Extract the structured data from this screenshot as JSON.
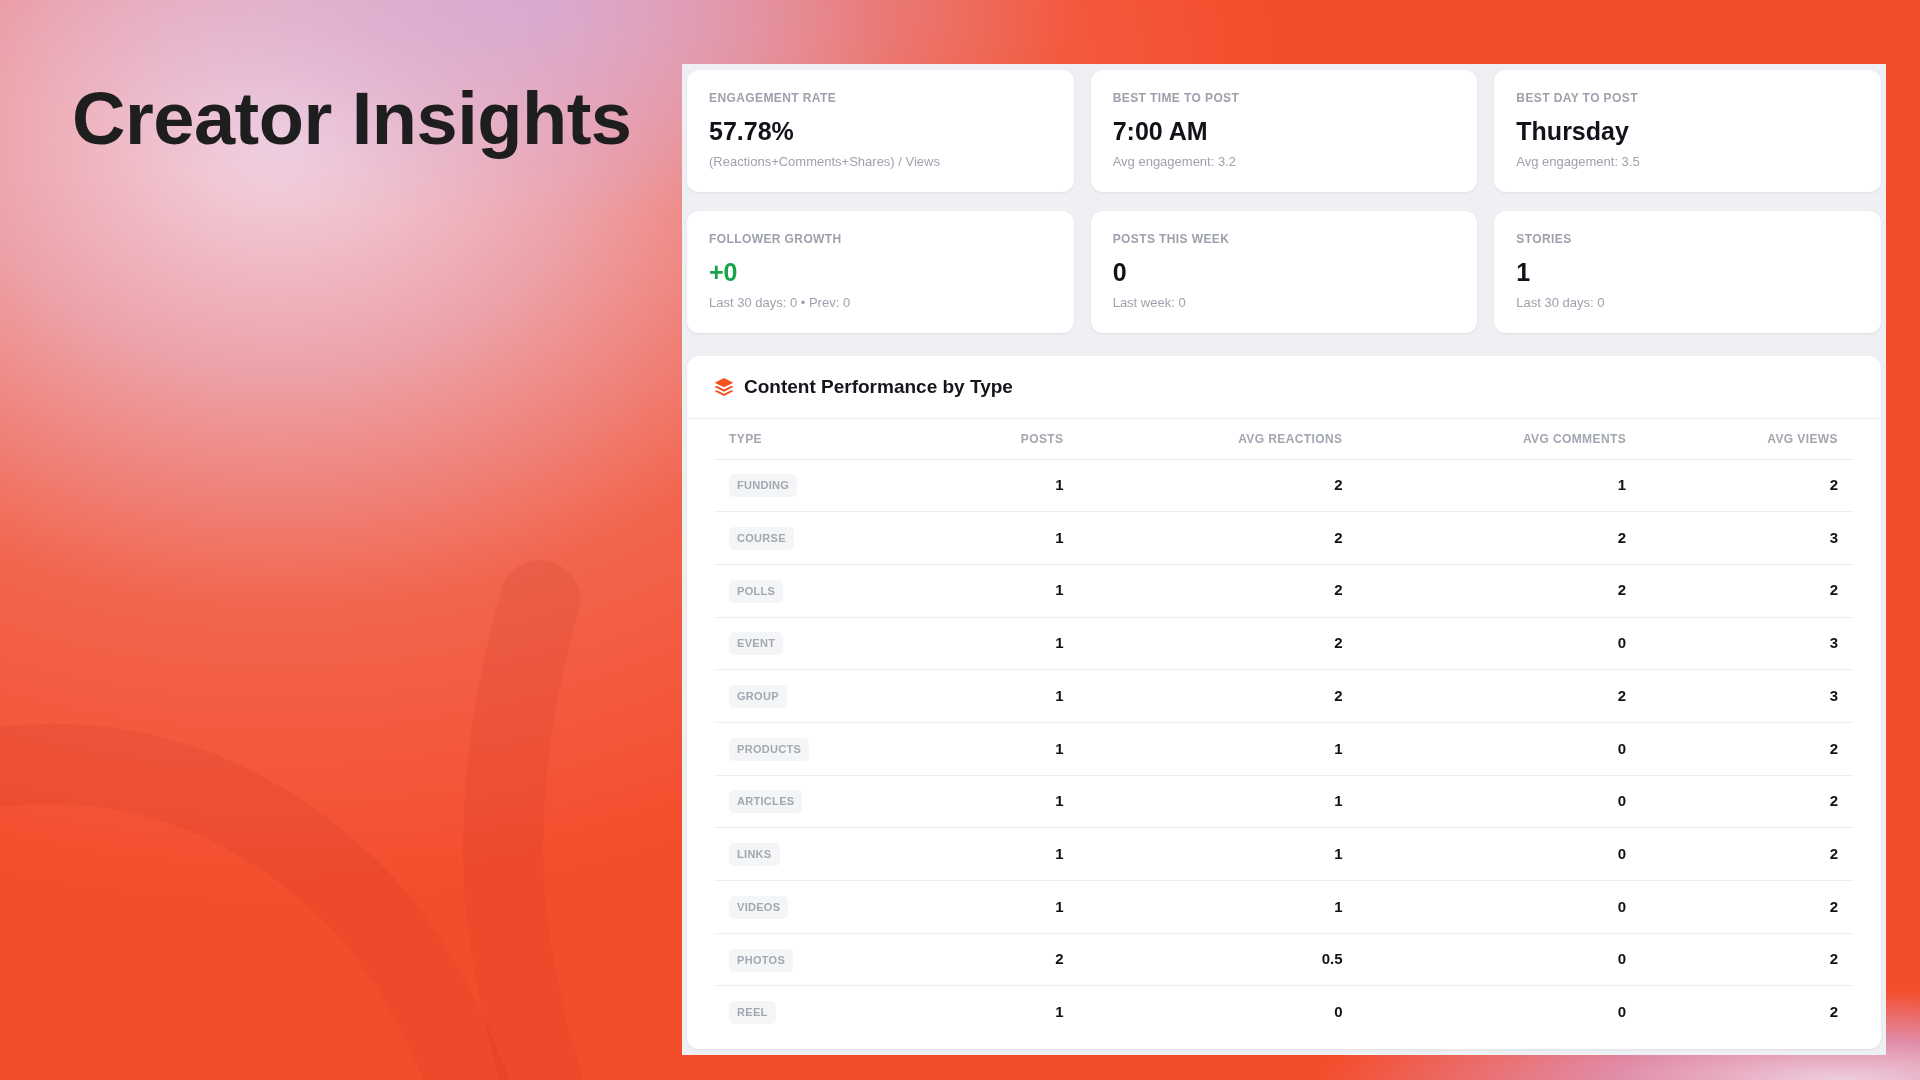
{
  "title": "Creator Insights",
  "stat_cards": [
    {
      "label": "ENGAGEMENT RATE",
      "value": "57.78%",
      "note": "(Reactions+Comments+Shares) / Views",
      "kind": "neutral"
    },
    {
      "label": "BEST TIME TO POST",
      "value": "7:00 AM",
      "note": "Avg engagement: 3.2",
      "kind": "neutral"
    },
    {
      "label": "BEST DAY TO POST",
      "value": "Thursday",
      "note": "Avg engagement: 3.5",
      "kind": "neutral"
    },
    {
      "label": "FOLLOWER GROWTH",
      "value": "+0",
      "note": "Last 30 days: 0 • Prev: 0",
      "kind": "positive"
    },
    {
      "label": "POSTS THIS WEEK",
      "value": "0",
      "note": "Last week: 0",
      "kind": "neutral"
    },
    {
      "label": "STORIES",
      "value": "1",
      "note": "Last 30 days: 0",
      "kind": "neutral"
    }
  ],
  "performance_table": {
    "title": "Content Performance by Type",
    "columns": [
      "TYPE",
      "POSTS",
      "AVG REACTIONS",
      "AVG COMMENTS",
      "AVG VIEWS"
    ],
    "rows": [
      [
        "FUNDING",
        "1",
        "2",
        "1",
        "2"
      ],
      [
        "COURSE",
        "1",
        "2",
        "2",
        "3"
      ],
      [
        "POLLS",
        "1",
        "2",
        "2",
        "2"
      ],
      [
        "EVENT",
        "1",
        "2",
        "0",
        "3"
      ],
      [
        "GROUP",
        "1",
        "2",
        "2",
        "3"
      ],
      [
        "PRODUCTS",
        "1",
        "1",
        "0",
        "2"
      ],
      [
        "ARTICLES",
        "1",
        "1",
        "0",
        "2"
      ],
      [
        "LINKS",
        "1",
        "1",
        "0",
        "2"
      ],
      [
        "VIDEOS",
        "1",
        "1",
        "0",
        "2"
      ],
      [
        "PHOTOS",
        "2",
        "0.5",
        "0",
        "2"
      ],
      [
        "REEL",
        "1",
        "0",
        "0",
        "2"
      ]
    ]
  }
}
